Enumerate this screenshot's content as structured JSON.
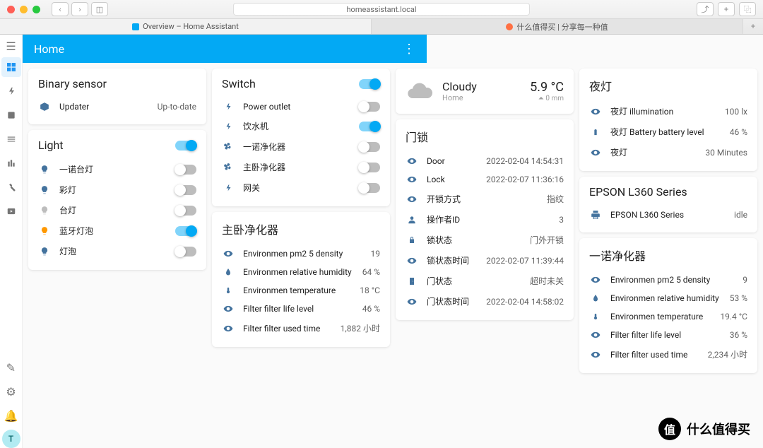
{
  "browser": {
    "url": "homeassistant.local",
    "tabs": [
      {
        "label": "Overview – Home Assistant",
        "active": true
      },
      {
        "label": "什么值得买 | 分享每一种值",
        "active": false
      }
    ]
  },
  "topbar": {
    "title": "Home"
  },
  "avatar_initial": "T",
  "cards": {
    "binary_sensor": {
      "title": "Binary sensor",
      "items": [
        {
          "icon": "package",
          "label": "Updater",
          "value": "Up-to-date"
        }
      ]
    },
    "light": {
      "title": "Light",
      "master_on": true,
      "items": [
        {
          "icon": "bulb",
          "color": "blue",
          "label": "一诺台灯",
          "on": false
        },
        {
          "icon": "bulb",
          "color": "blue",
          "label": "彩灯",
          "on": false
        },
        {
          "icon": "bulb",
          "color": "dim",
          "label": "台灯",
          "on": false
        },
        {
          "icon": "bulb",
          "color": "orange",
          "label": "蓝牙灯泡",
          "on": true
        },
        {
          "icon": "bulb",
          "color": "blue",
          "label": "灯泡",
          "on": false
        }
      ]
    },
    "switch": {
      "title": "Switch",
      "master_on": true,
      "items": [
        {
          "icon": "flash",
          "label": "Power outlet",
          "on": false
        },
        {
          "icon": "flash",
          "label": "饮水机",
          "on": true
        },
        {
          "icon": "fan",
          "label": "一诺净化器",
          "on": false
        },
        {
          "icon": "fan",
          "label": "主卧净化器",
          "on": false
        },
        {
          "icon": "flash",
          "label": "网关",
          "on": false
        }
      ]
    },
    "purifier_master": {
      "title": "主卧净化器",
      "items": [
        {
          "icon": "eye",
          "label": "Environmen pm2 5 density",
          "value": "19"
        },
        {
          "icon": "water",
          "label": "Environmen relative humidity",
          "value": "64 %"
        },
        {
          "icon": "thermo",
          "label": "Environmen temperature",
          "value": "18 °C"
        },
        {
          "icon": "eye",
          "label": "Filter filter life level",
          "value": "46 %"
        },
        {
          "icon": "eye",
          "label": "Filter filter used time",
          "value": "1,882 小时"
        }
      ]
    },
    "weather": {
      "condition": "Cloudy",
      "location": "Home",
      "temp": "5.9 °C",
      "extra": "0 mm"
    },
    "doorlock": {
      "title": "门锁",
      "items": [
        {
          "icon": "eye",
          "label": "Door",
          "value": "2022-02-04 14:54:31"
        },
        {
          "icon": "eye",
          "label": "Lock",
          "value": "2022-02-07 11:36:16"
        },
        {
          "icon": "eye",
          "label": "开锁方式",
          "value": "指纹"
        },
        {
          "icon": "person",
          "label": "操作者ID",
          "value": "3"
        },
        {
          "icon": "lock",
          "label": "锁状态",
          "value": "门外开锁"
        },
        {
          "icon": "eye",
          "label": "锁状态时间",
          "value": "2022-02-07 11:39:44"
        },
        {
          "icon": "door",
          "label": "门状态",
          "value": "超时未关"
        },
        {
          "icon": "eye",
          "label": "门状态时间",
          "value": "2022-02-04 14:58:02"
        }
      ]
    },
    "nightlight": {
      "title": "夜灯",
      "items": [
        {
          "icon": "eye",
          "label": "夜灯 illumination",
          "value": "100 lx"
        },
        {
          "icon": "battery",
          "label": "夜灯 Battery battery level",
          "value": "46 %"
        },
        {
          "icon": "eye",
          "label": "夜灯",
          "value": "30 Minutes"
        }
      ]
    },
    "printer": {
      "title": "EPSON L360 Series",
      "items": [
        {
          "icon": "printer",
          "label": "EPSON L360 Series",
          "value": "idle"
        }
      ]
    },
    "purifier_yinuo": {
      "title": "一诺净化器",
      "items": [
        {
          "icon": "eye",
          "label": "Environmen pm2 5 density",
          "value": "9"
        },
        {
          "icon": "water",
          "label": "Environmen relative humidity",
          "value": "53 %"
        },
        {
          "icon": "thermo",
          "label": "Environmen temperature",
          "value": "19.4 °C"
        },
        {
          "icon": "eye",
          "label": "Filter filter life level",
          "value": "36 %"
        },
        {
          "icon": "eye",
          "label": "Filter filter used time",
          "value": "2,234 小时"
        }
      ]
    }
  },
  "watermark": "什么值得买"
}
